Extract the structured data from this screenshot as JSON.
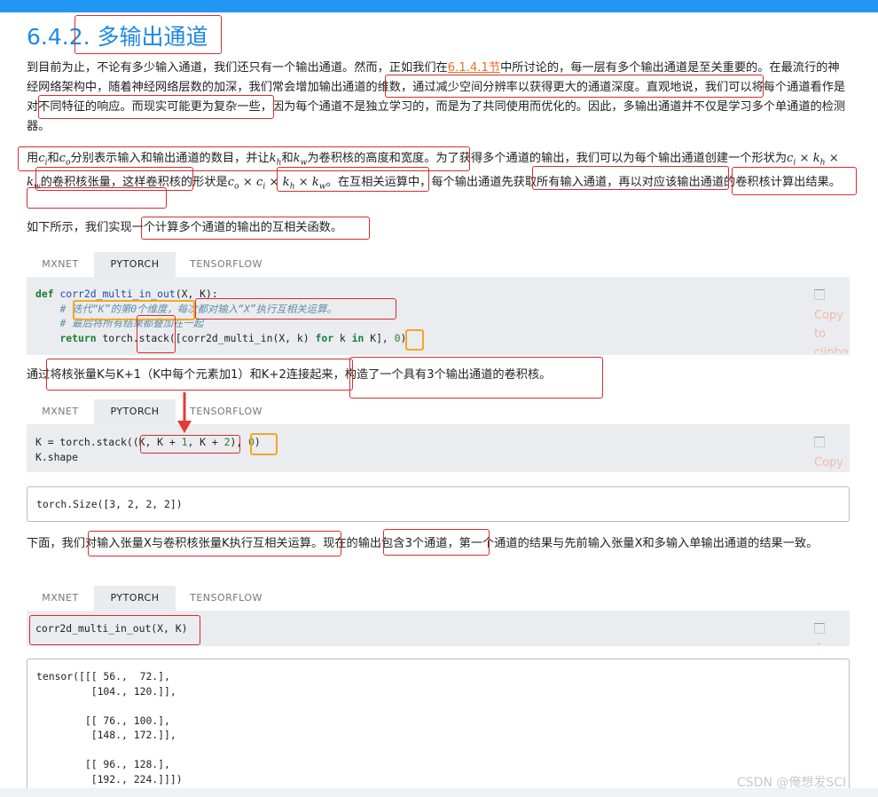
{
  "heading": {
    "number": "6.4.2.",
    "title": "多输出通道"
  },
  "para1": {
    "t1": "到目前为止，不论有多少输入通道，我们还只有一个输出通道。然而，正如我们在",
    "link": "6.1.4.1节",
    "t2": "中所讨论的，每一层有多个输出通道是至关重要的。在最流行的神经网络架构中，随着神经网络层数的加深，我们常会增加输出通道的维数，通过减少空间分辨率以获得更大的通道深度。直观地说，我们可以将每个通道看作是对不同特征的响应。而现实可能更为复杂一些，因为每个通道不是独立学习的，而是为了共同使用而优化的。因此，多输出通道并不仅是学习多个单通道的检测器。"
  },
  "para2": {
    "t1": "用",
    "t2": "和",
    "t3": "分别表示输入和输出通道的数目，并让",
    "t4": "和",
    "t5": "为卷积核的高度和宽度。为了获得多个通道的输出，我们可以为每个输出通道创建一个形状为",
    "t6": "的卷积核张量，这样卷积核的形状是",
    "t7": "。在互相关运算中，每个输出通道先获取所有输入通道，再以对应该输出通道的卷积核计算出结果。",
    "math_ci": "c",
    "sub_i": "i",
    "math_co": "c",
    "sub_o": "o",
    "math_kh": "k",
    "sub_h": "h",
    "math_kw": "k",
    "sub_w": "w",
    "shape1": "c<sub>i</sub> × k<sub>h</sub> × k<sub>w</sub>",
    "shape2": "c<sub>o</sub> × c<sub>i</sub> × k<sub>h</sub> × k<sub>w</sub>"
  },
  "para3": "如下所示，我们实现一个计算多个通道的输出的互相关函数。",
  "tabs": [
    "MXNET",
    "PYTORCH",
    "TENSORFLOW"
  ],
  "code1": {
    "l1_kw": "def",
    "l1_fn": "corr2d_multi_in_out",
    "l1_rest": "(X, K):",
    "l2": "# 迭代“K”的第0个维度，每次都对输入“X”执行互相关运算。",
    "l3": "# 最后将所有结果都叠加在一起",
    "l4_kw": "return",
    "l4_a": "torch.stack([corr2d_multi_in(X, k)",
    "l4_for": "for",
    "l4_b": "k",
    "l4_in": "in",
    "l4_c": "K],",
    "l4_num": "0",
    "l4_end": ")"
  },
  "copy": {
    "line1": "Copy",
    "line2": "to",
    "line3": "clipbo"
  },
  "para4": "通过将核张量K与K+1（K中每个元素加1）和K+2连接起来，构造了一个具有3个输出通道的卷积核。",
  "code2": {
    "l1_a": "K = torch.stack((K, K + ",
    "l1_n1": "1",
    "l1_b": ", K + ",
    "l1_n2": "2",
    "l1_c": "), ",
    "l1_n0": "0",
    "l1_d": ")",
    "l2": "K.shape"
  },
  "output1": "torch.Size([3, 2, 2, 2])",
  "para5": "下面，我们对输入张量X与卷积核张量K执行互相关运算。现在的输出包含3个通道，第一个通道的结果与先前输入张量X和多输入单输出通道的结果一致。",
  "code3": "corr2d_multi_in_out(X, K)",
  "output2": "tensor([[[ 56.,  72.],\n         [104., 120.]],\n\n        [[ 76., 100.],\n         [148., 172.]],\n\n        [[ 96., 128.],\n         [192., 224.]]])",
  "watermark": "CSDN @俺想发SCI",
  "colors": {
    "accent": "#1e88e5",
    "annotation_red": "#d32f2f",
    "annotation_yellow": "#f5a623",
    "link": "#e8702a"
  }
}
